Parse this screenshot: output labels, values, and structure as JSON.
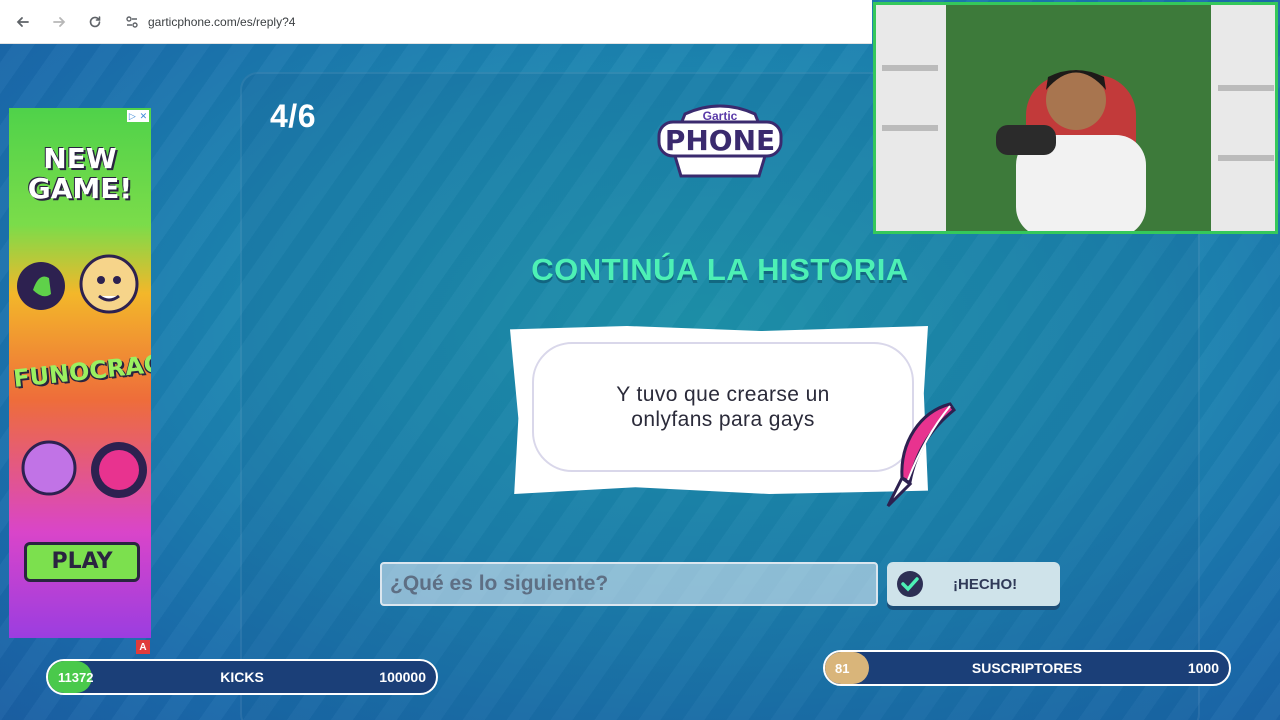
{
  "browser": {
    "url": "garticphone.com/es/reply?4"
  },
  "game": {
    "step_counter": "4/6",
    "logo_line1": "Gartic",
    "logo_line2": "PHONE",
    "title": "CONTINÚA LA HISTORIA",
    "story_text": "Y tuvo que crearse un onlyfans para gays",
    "input_placeholder": "¿Qué es lo siguiente?",
    "done_label": "¡HECHO!"
  },
  "ad": {
    "headline_line1": "NEW",
    "headline_line2": "GAME!",
    "brand": "FUNOCRACY",
    "play_label": "PLAY",
    "badge": "A"
  },
  "overlay": {
    "kicks": {
      "current": "11372",
      "label": "KICKS",
      "target": "100000",
      "progress": 0.114
    },
    "subs": {
      "current": "81",
      "label": "SUSCRIPTORES",
      "target": "1000",
      "progress": 0.081
    }
  },
  "colors": {
    "title_green": "#4df0b5",
    "kicks_fill": "#4ac94b",
    "subs_fill": "#d9b57a",
    "webcam_border": "#35c85b"
  }
}
